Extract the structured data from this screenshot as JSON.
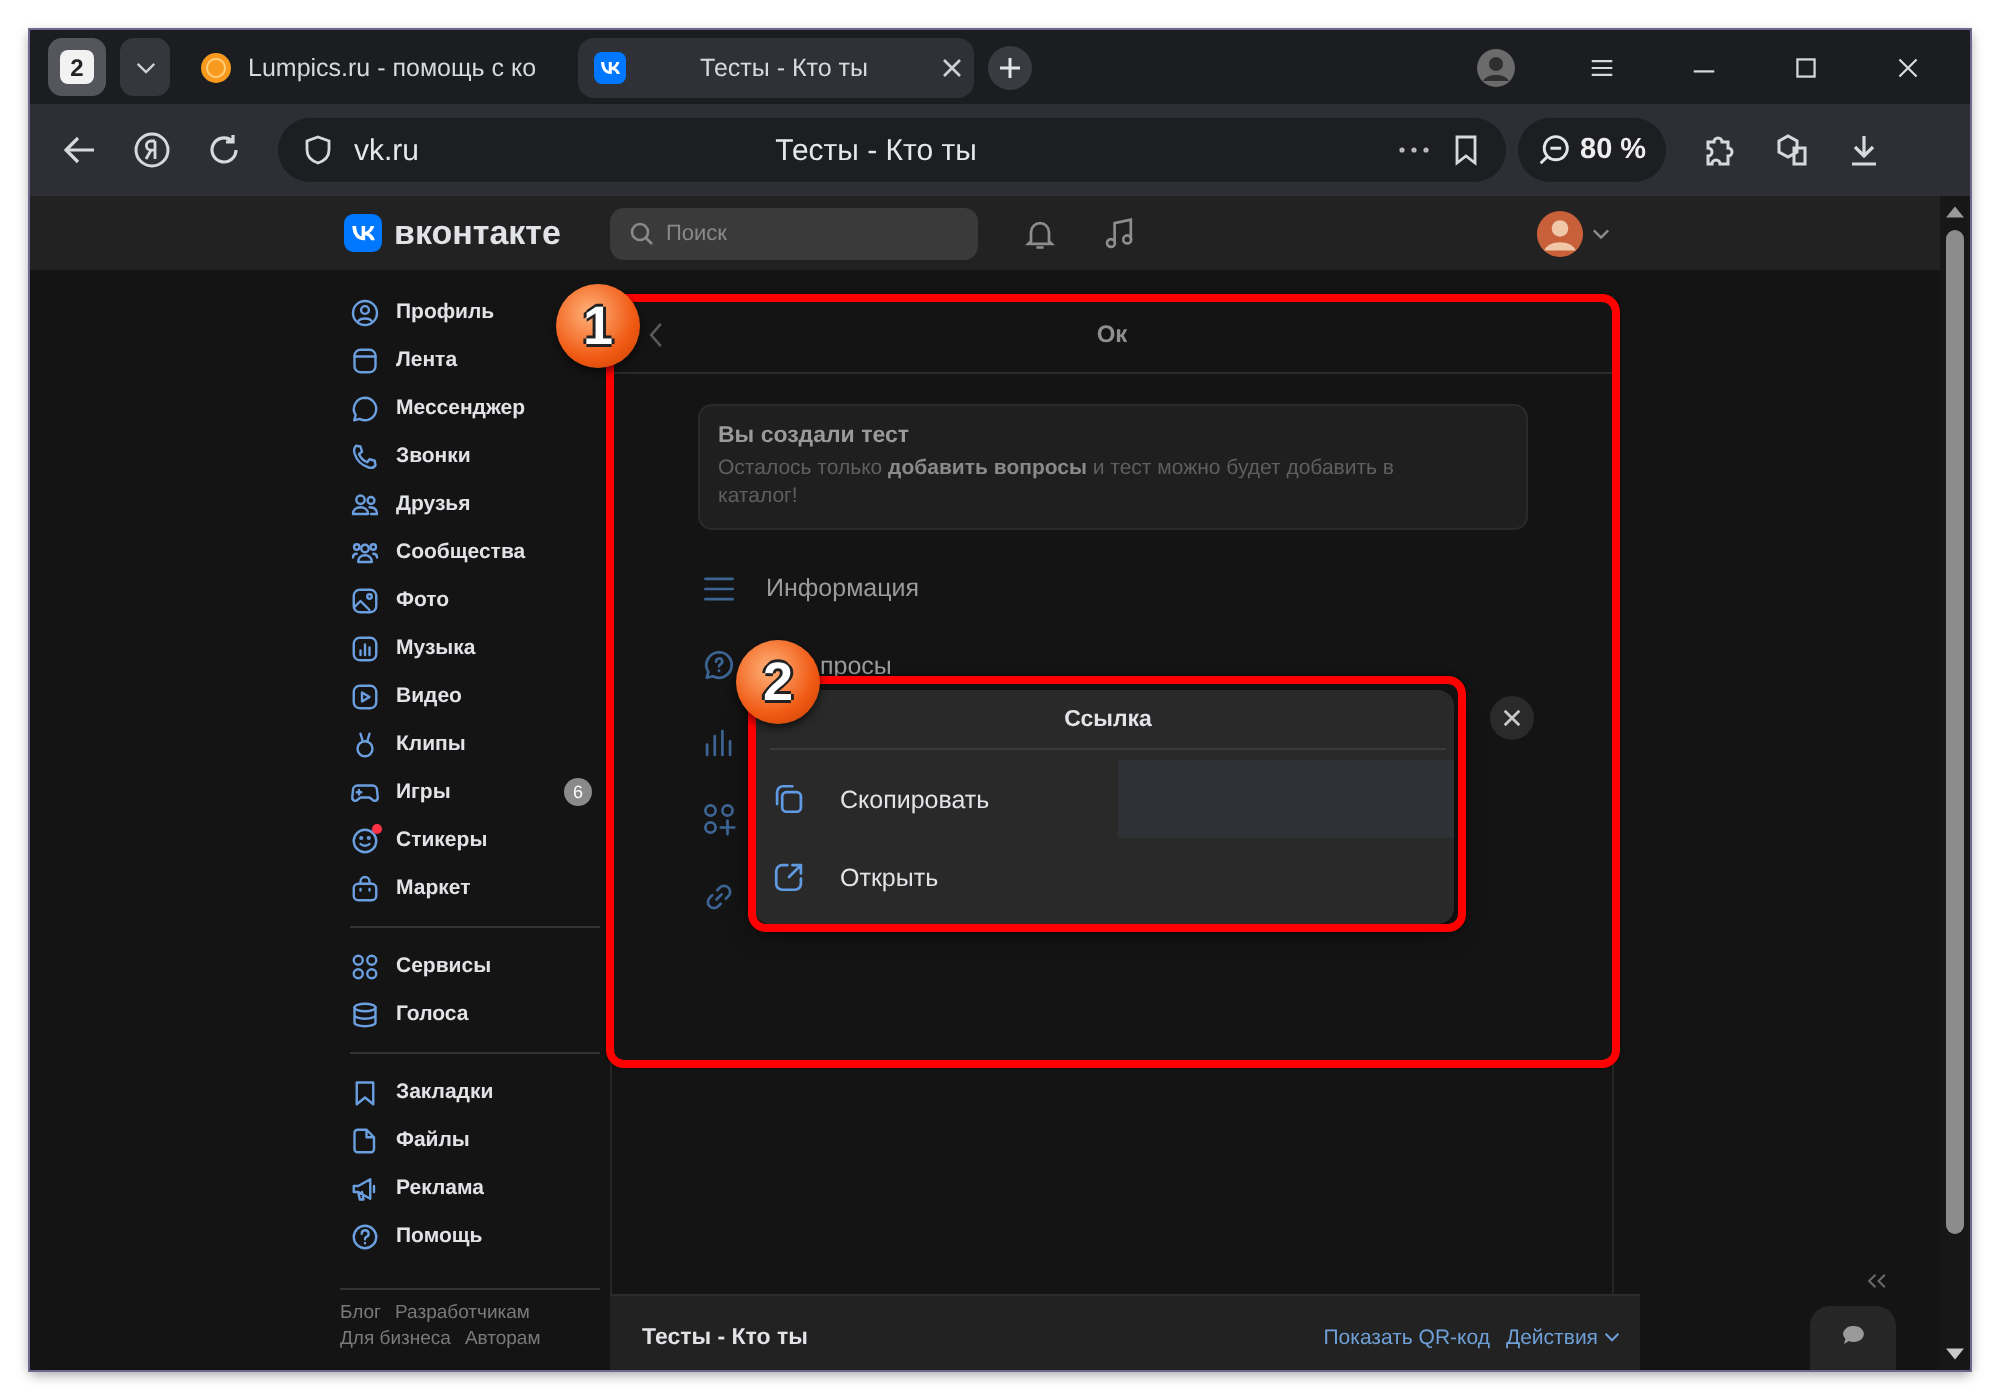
{
  "browser": {
    "tab_count": "2",
    "tabs": [
      {
        "kind": "lumpics",
        "title": "Lumpics.ru - помощь с ко",
        "selected": false
      },
      {
        "kind": "vk",
        "title": "Тесты - Кто ты",
        "selected": true
      }
    ],
    "address": {
      "domain": "vk.ru",
      "page_title": "Тесты - Кто ты"
    },
    "zoom": "80 %"
  },
  "vk": {
    "logo": "вконтакте",
    "search": {
      "placeholder": "Поиск"
    },
    "sidebar": {
      "groups": [
        {
          "items": [
            {
              "kind": "profile",
              "label": "Профиль"
            },
            {
              "kind": "feed",
              "label": "Лента"
            },
            {
              "kind": "messenger",
              "label": "Мессенджер"
            },
            {
              "kind": "calls",
              "label": "Звонки"
            },
            {
              "kind": "friends",
              "label": "Друзья"
            },
            {
              "kind": "communities",
              "label": "Сообщества"
            },
            {
              "kind": "photo",
              "label": "Фото"
            },
            {
              "kind": "music",
              "label": "Музыка"
            },
            {
              "kind": "video",
              "label": "Видео"
            },
            {
              "kind": "clips",
              "label": "Клипы"
            },
            {
              "kind": "games",
              "label": "Игры",
              "counter": "6"
            },
            {
              "kind": "stickers",
              "label": "Стикеры",
              "dot": true
            },
            {
              "kind": "market",
              "label": "Маркет"
            }
          ]
        },
        {
          "items": [
            {
              "kind": "services",
              "label": "Сервисы"
            },
            {
              "kind": "voices",
              "label": "Голоса"
            }
          ]
        },
        {
          "items": [
            {
              "kind": "bookmarks",
              "label": "Закладки"
            },
            {
              "kind": "files",
              "label": "Файлы"
            },
            {
              "kind": "ads",
              "label": "Реклама"
            },
            {
              "kind": "help",
              "label": "Помощь"
            }
          ]
        }
      ],
      "footer_links": [
        "Блог",
        "Разработчикам",
        "Для бизнеса",
        "Авторам"
      ]
    }
  },
  "panel": {
    "title": "Ок",
    "notice": {
      "title": "Вы создали тест",
      "text": "Осталось только **добавить вопросы** и тест можно будет добавить в каталог!"
    },
    "menu": [
      {
        "kind": "info",
        "label": "Информация"
      },
      {
        "kind": "questions",
        "label": "просы"
      },
      {
        "kind": "stats"
      },
      {
        "kind": "apps"
      },
      {
        "kind": "link"
      }
    ]
  },
  "popup": {
    "title": "Ссылка",
    "items": [
      {
        "kind": "copy",
        "label": "Скопировать",
        "selected": true
      },
      {
        "kind": "open",
        "label": "Открыть",
        "selected": false
      }
    ]
  },
  "footer": {
    "title": "Тесты - Кто ты",
    "qr": "Показать QR-код",
    "actions": "Действия"
  },
  "annotations": [
    {
      "number": "1"
    },
    {
      "number": "2"
    }
  ]
}
